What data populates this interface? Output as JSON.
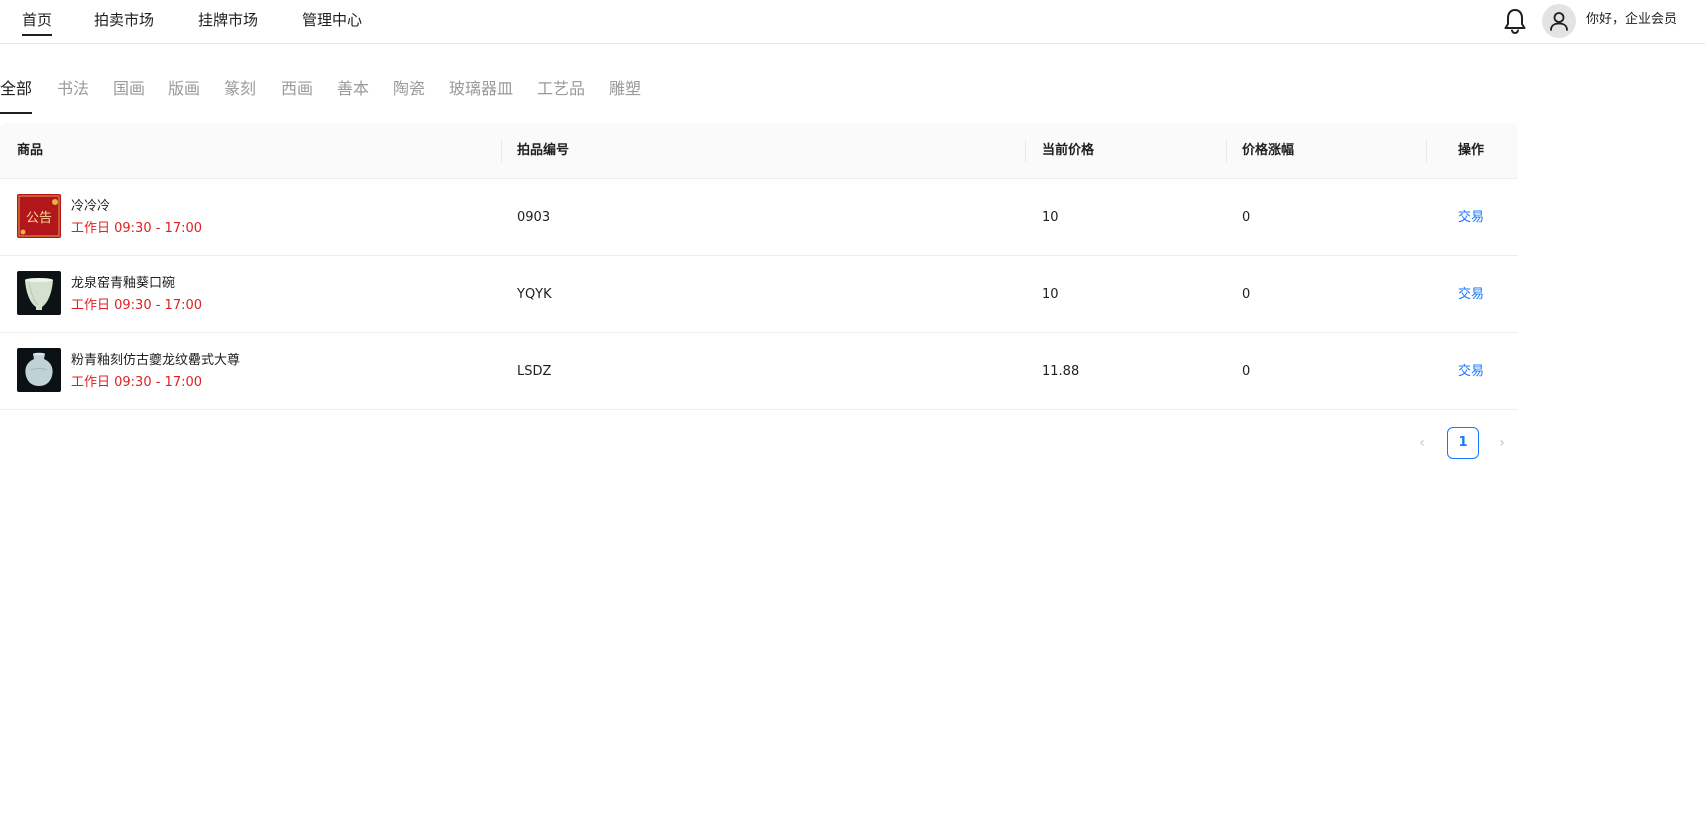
{
  "nav": {
    "items": [
      {
        "label": "首页",
        "active": true
      },
      {
        "label": "拍卖市场",
        "active": false
      },
      {
        "label": "挂牌市场",
        "active": false
      },
      {
        "label": "管理中心",
        "active": false
      }
    ],
    "greeting": "你好，企业会员",
    "icons": [
      "bell-icon",
      "user-icon"
    ]
  },
  "categories": [
    {
      "label": "全部",
      "active": true
    },
    {
      "label": "书法"
    },
    {
      "label": "国画"
    },
    {
      "label": "版画"
    },
    {
      "label": "篆刻"
    },
    {
      "label": "西画"
    },
    {
      "label": "善本"
    },
    {
      "label": "陶瓷"
    },
    {
      "label": "玻璃器皿"
    },
    {
      "label": "工艺品"
    },
    {
      "label": "雕塑"
    }
  ],
  "table": {
    "headers": {
      "product": "商品",
      "lot_no": "拍品编号",
      "price": "当前价格",
      "change": "价格涨幅",
      "action": "操作"
    },
    "rows": [
      {
        "name": "冷冷冷",
        "hours": "工作日 09:30 - 17:00",
        "lot_no": "0903",
        "price": "10",
        "change": "0",
        "action": "交易",
        "thumb_text": "公告"
      },
      {
        "name": "龙泉窑青釉葵口碗",
        "hours": "工作日 09:30 - 17:00",
        "lot_no": "YQYK",
        "price": "10",
        "change": "0",
        "action": "交易"
      },
      {
        "name": "粉青釉刻仿古夔龙纹罍式大尊",
        "hours": "工作日 09:30 - 17:00",
        "lot_no": "LSDZ",
        "price": "11.88",
        "change": "0",
        "action": "交易"
      }
    ]
  },
  "pagination": {
    "prev": "‹",
    "current": "1",
    "next": "›"
  },
  "colors": {
    "accent": "#1677ff",
    "time_red": "#e02020",
    "header_bg": "#fafafa"
  }
}
